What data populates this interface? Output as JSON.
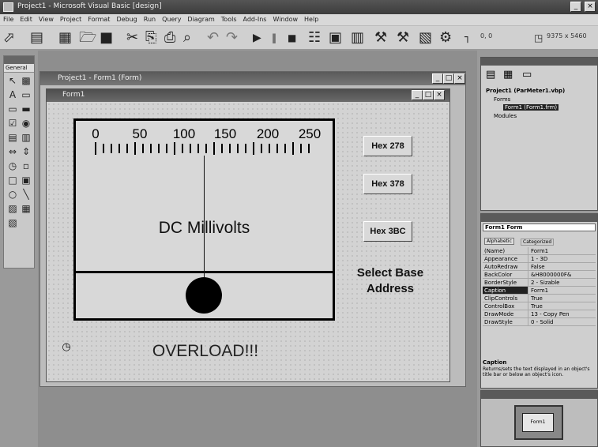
{
  "window": {
    "title": "Project1 - Microsoft Visual Basic [design]",
    "controls": [
      "_",
      "×"
    ]
  },
  "menu": [
    "File",
    "Edit",
    "View",
    "Project",
    "Format",
    "Debug",
    "Run",
    "Query",
    "Diagram",
    "Tools",
    "Add-Ins",
    "Window",
    "Help"
  ],
  "toolbar": {
    "position": "0, 0",
    "size": "9375 x 5460"
  },
  "toolbox": {
    "title": "General"
  },
  "project_window": {
    "title": "Project1 - Form1 (Form)",
    "controls": [
      "_",
      "□",
      "×"
    ]
  },
  "form": {
    "title": "Form1",
    "controls": [
      "_",
      "□",
      "×"
    ],
    "meter": {
      "scale_labels": [
        "0",
        "50",
        "100",
        "150",
        "200",
        "250"
      ],
      "label": "DC Millivolts"
    },
    "hex_buttons": [
      "Hex 278",
      "Hex 378",
      "Hex 3BC"
    ],
    "select_base_line1": "Select Base",
    "select_base_line2": "Address",
    "overload": "OVERLOAD!!!"
  },
  "project_explorer": {
    "root": "Project1 (ParMeter1.vbp)",
    "forms_folder": "Forms",
    "form_item": "Form1 (Form1.frm)",
    "modules_folder": "Modules"
  },
  "properties": {
    "object": "Form1  Form",
    "tabs": [
      "Alphabetic",
      "Categorized"
    ],
    "rows": [
      {
        "k": "(Name)",
        "v": "Form1"
      },
      {
        "k": "Appearance",
        "v": "1 - 3D"
      },
      {
        "k": "AutoRedraw",
        "v": "False"
      },
      {
        "k": "BackColor",
        "v": "&H8000000F&"
      },
      {
        "k": "BorderStyle",
        "v": "2 - Sizable"
      },
      {
        "k": "Caption",
        "v": "Form1",
        "selected": true
      },
      {
        "k": "ClipControls",
        "v": "True"
      },
      {
        "k": "ControlBox",
        "v": "True"
      },
      {
        "k": "DrawMode",
        "v": "13 - Copy Pen"
      },
      {
        "k": "DrawStyle",
        "v": "0 - Solid"
      }
    ],
    "desc_title": "Caption",
    "desc_text": "Returns/sets the text displayed in an object's title bar or below an object's icon."
  },
  "form_layout": {
    "label": "Form1"
  }
}
